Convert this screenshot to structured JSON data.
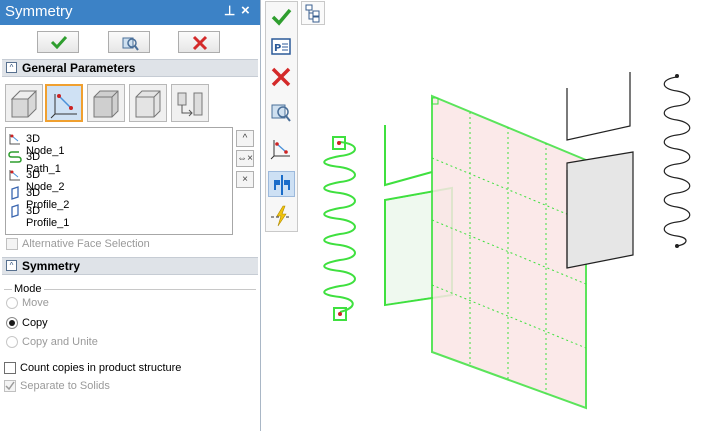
{
  "window": {
    "title": "Symmetry",
    "pin_glyph": "⊥",
    "close_glyph": "×"
  },
  "toolbar": {
    "ok": "ok-check-icon",
    "preview": "preview-icon",
    "cancel": "cancel-x-icon"
  },
  "general_parameters": {
    "title": "General Parameters",
    "modes": [
      "symmetry-face-icon",
      "symmetry-node-icon",
      "symmetry-solid-icon",
      "symmetry-plane-icon",
      "symmetry-assembly-icon"
    ],
    "selected_mode": 1,
    "items": [
      {
        "label": "3D Node_1",
        "icon": "node-icon"
      },
      {
        "label": "3D Path_1",
        "icon": "path-icon"
      },
      {
        "label": "3D Node_2",
        "icon": "node-icon"
      },
      {
        "label": "3D Profile_2",
        "icon": "profile-icon"
      },
      {
        "label": "3D Profile_1",
        "icon": "profile-icon"
      }
    ],
    "side_buttons": [
      "^",
      "⇔×",
      "×"
    ],
    "alternative_face_selection": "Alternative Face Selection"
  },
  "symmetry": {
    "title": "Symmetry",
    "mode_label": "Mode",
    "options": [
      {
        "label": "Move",
        "selected": false,
        "enabled": false
      },
      {
        "label": "Copy",
        "selected": true,
        "enabled": true
      },
      {
        "label": "Copy and Unite",
        "selected": false,
        "enabled": false
      }
    ],
    "count_copies": {
      "label": "Count copies in product structure",
      "checked": false
    },
    "separate_to_solids": {
      "label": "Separate to Solids",
      "checked": true,
      "enabled": false
    }
  },
  "vertical_toolbar": [
    "ok-check-icon",
    "parameters-icon",
    "cancel-x-icon",
    "preview-icon",
    "node-axis-icon",
    "symmetry-icon",
    "lightning-icon"
  ],
  "colors": {
    "accent": "#3c82c6",
    "ok": "#2f9e2f",
    "cancel": "#d42a2a",
    "selection": "#3fe03f",
    "highlight": "#f0a030"
  }
}
